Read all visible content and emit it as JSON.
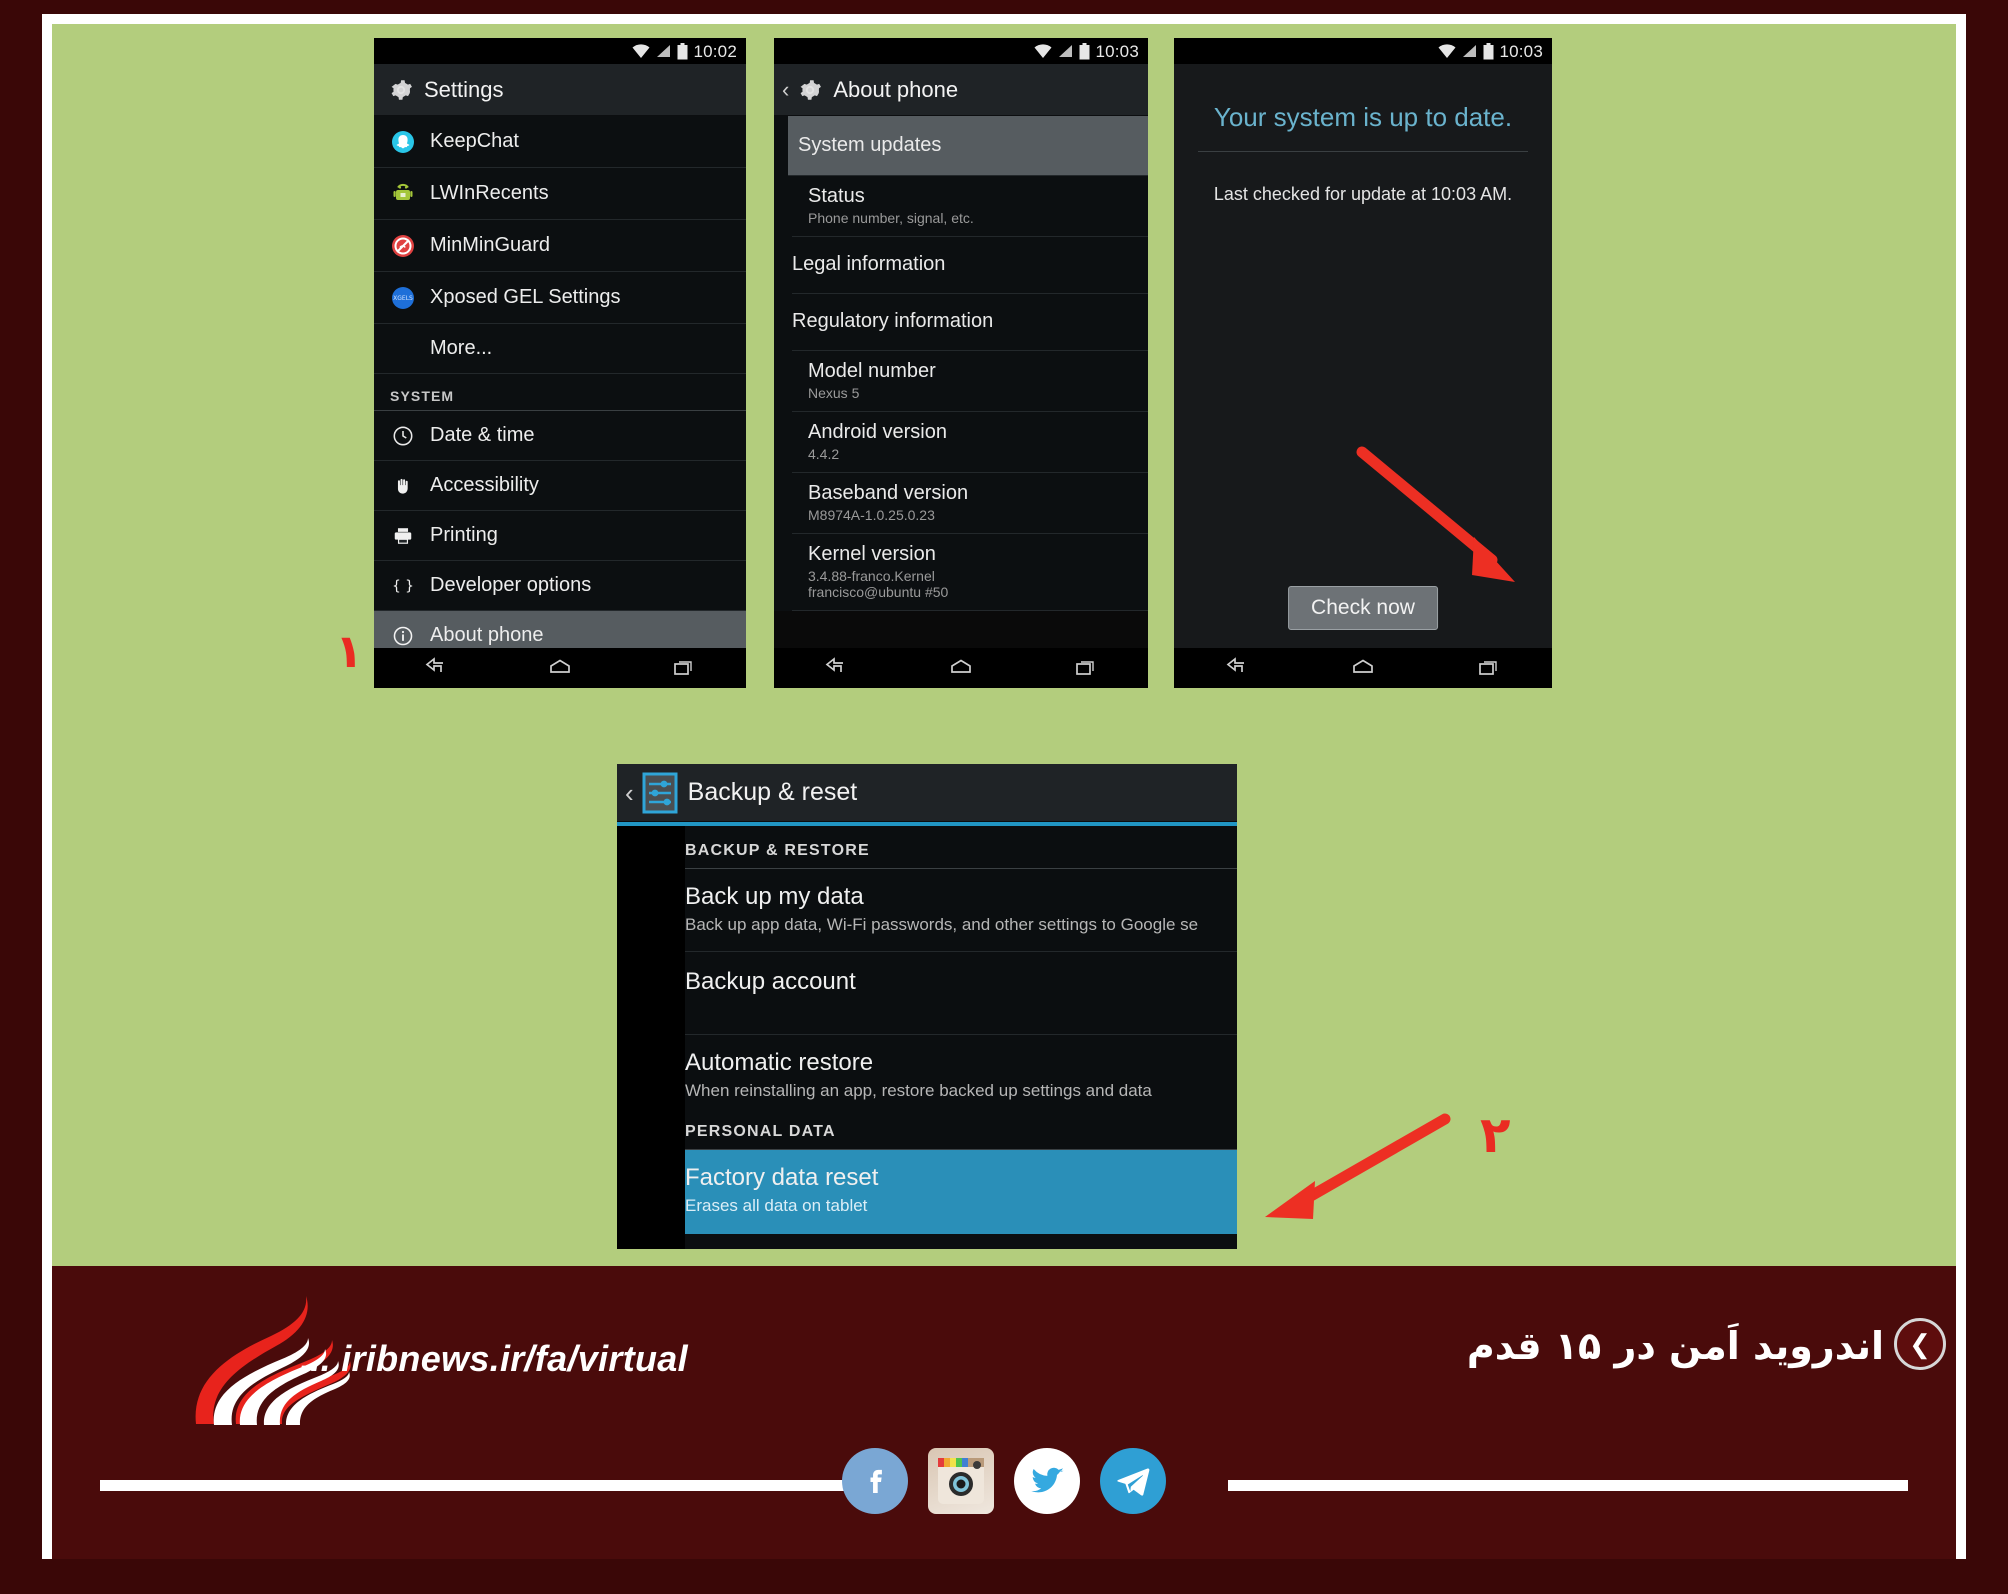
{
  "colors": {
    "outer_frame": "#3a0707",
    "stage_green": "#b3cd7d",
    "banner_maroon": "#4a0b0b",
    "accent_blue": "#2a8fb8",
    "update_title_blue": "#6ab3cd",
    "arrow_red": "#ea2b22"
  },
  "phone1": {
    "status": {
      "time": "10:02",
      "wifi_icon": "wifi-icon",
      "signal_icon": "signal-icon",
      "battery_icon": "battery-icon"
    },
    "header": {
      "icon": "settings-gear-icon",
      "title": "Settings"
    },
    "apps": [
      {
        "label": "KeepChat",
        "icon": "keepchat-app-icon"
      },
      {
        "label": "LWInRecents",
        "icon": "lwinrecents-app-icon"
      },
      {
        "label": "MinMinGuard",
        "icon": "minminguard-app-icon"
      },
      {
        "label": "Xposed GEL Settings",
        "icon": "xposed-gel-app-icon"
      }
    ],
    "more_label": "More...",
    "section_system": "SYSTEM",
    "system_items": [
      {
        "label": "Date & time",
        "icon": "clock-icon",
        "selected": false
      },
      {
        "label": "Accessibility",
        "icon": "hand-icon",
        "selected": false
      },
      {
        "label": "Printing",
        "icon": "printer-icon",
        "selected": false
      },
      {
        "label": "Developer options",
        "icon": "braces-icon",
        "selected": false
      },
      {
        "label": "About phone",
        "icon": "info-circle-icon",
        "selected": true
      }
    ],
    "nav": {
      "back": "back-nav-icon",
      "home": "home-nav-icon",
      "recents": "recents-nav-icon"
    }
  },
  "phone2": {
    "status": {
      "time": "10:03",
      "wifi_icon": "wifi-icon",
      "signal_icon": "signal-icon",
      "battery_icon": "battery-icon"
    },
    "header": {
      "icon": "settings-gear-icon",
      "title": "About phone",
      "back": "back-caret-icon"
    },
    "items": [
      {
        "title": "System updates",
        "summary": "",
        "selected": true
      },
      {
        "title": "Status",
        "summary": "Phone number, signal, etc.",
        "selected": false
      },
      {
        "title": "Legal information",
        "summary": "",
        "selected": false
      },
      {
        "title": "Regulatory information",
        "summary": "",
        "selected": false
      },
      {
        "title": "Model number",
        "summary": "Nexus 5",
        "selected": false
      },
      {
        "title": "Android version",
        "summary": "4.4.2",
        "selected": false
      },
      {
        "title": "Baseband version",
        "summary": "M8974A-1.0.25.0.23",
        "selected": false
      },
      {
        "title": "Kernel version",
        "summary": "3.4.88-franco.Kernel\nfrancisco@ubuntu #50",
        "selected": false
      }
    ],
    "nav": {
      "back": "back-nav-icon",
      "home": "home-nav-icon",
      "recents": "recents-nav-icon"
    }
  },
  "phone3": {
    "status": {
      "time": "10:03",
      "wifi_icon": "wifi-icon",
      "signal_icon": "signal-icon",
      "battery_icon": "battery-icon"
    },
    "title": "Your system is up to date.",
    "subtitle": "Last checked for update at 10:03 AM.",
    "check_button": "Check now",
    "nav": {
      "back": "back-nav-icon",
      "home": "home-nav-icon",
      "recents": "recents-nav-icon"
    }
  },
  "backup_panel": {
    "header": {
      "icon": "backup-reset-icon",
      "title": "Backup & reset",
      "back": "back-caret-icon"
    },
    "section_backup": "BACKUP & RESTORE",
    "section_personal": "PERSONAL DATA",
    "rows": [
      {
        "title": "Back up my data",
        "summary": "Back up app data, Wi-Fi passwords, and other settings to Google se",
        "highlight": false
      },
      {
        "title": "Backup account",
        "summary": "",
        "highlight": false
      },
      {
        "title": "Automatic restore",
        "summary": "When reinstalling an app, restore backed up settings and data",
        "highlight": false
      },
      {
        "title": "Factory data reset",
        "summary": "Erases all data on tablet",
        "highlight": true
      }
    ]
  },
  "annotations": {
    "step_one": "۱",
    "step_two": "۲"
  },
  "banner": {
    "logo": "iribnews-logo",
    "url": "... iribnews.ir/fa/virtual",
    "title_fa": "اندروید اَمن در ۱۵ قدم",
    "prev_icon": "prev-arrow-icon",
    "socials": [
      {
        "name": "facebook-icon",
        "glyph": "f"
      },
      {
        "name": "instagram-icon",
        "glyph": ""
      },
      {
        "name": "twitter-icon",
        "glyph": ""
      },
      {
        "name": "telegram-icon",
        "glyph": ""
      }
    ]
  }
}
